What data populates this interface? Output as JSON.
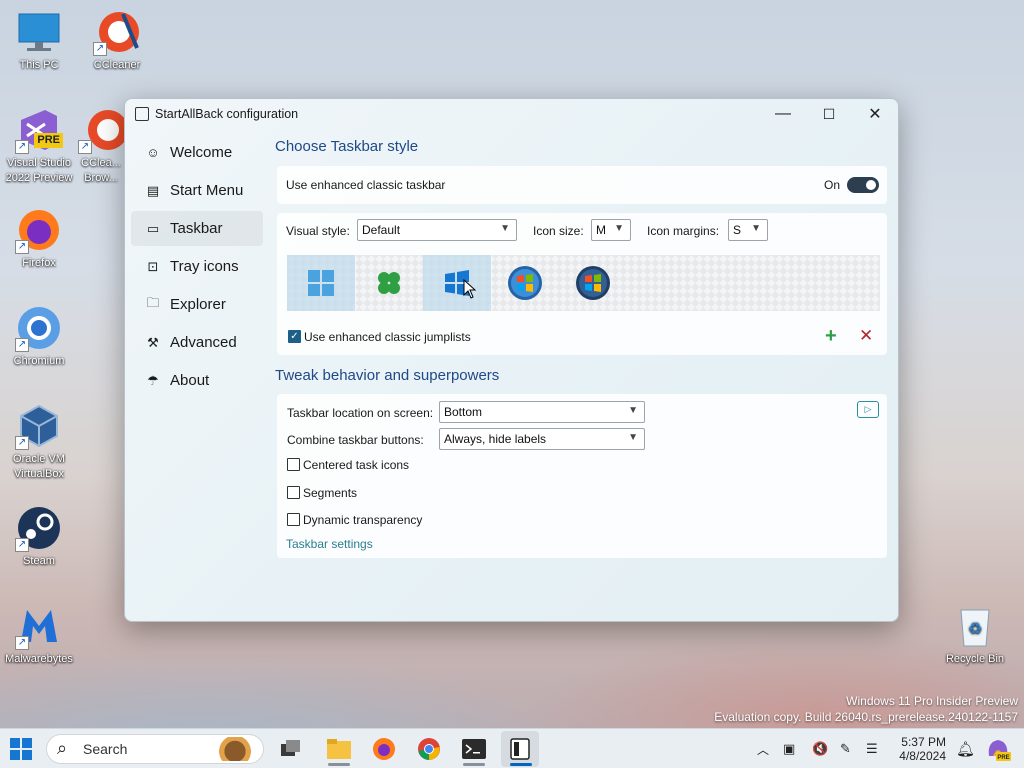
{
  "desktop": {
    "icons": [
      {
        "label": "This PC",
        "icon": "monitor-icon"
      },
      {
        "label": "CCleaner",
        "icon": "ccleaner-icon"
      },
      {
        "label": "Visual Studio 2022 Preview",
        "icon": "visual-studio-icon",
        "badge": "PRE"
      },
      {
        "label": "CClea... Brow...",
        "icon": "ccleaner-browser-icon"
      },
      {
        "label": "Firefox",
        "icon": "firefox-icon"
      },
      {
        "label": "Chromium",
        "icon": "chromium-icon"
      },
      {
        "label": "Oracle VM VirtualBox",
        "icon": "virtualbox-icon"
      },
      {
        "label": "Steam",
        "icon": "steam-icon"
      },
      {
        "label": "Malwarebytes",
        "icon": "malwarebytes-icon"
      },
      {
        "label": "Recycle Bin",
        "icon": "recycle-bin-icon"
      }
    ],
    "watermark_line1": "Windows 11 Pro Insider Preview",
    "watermark_line2": "Evaluation copy. Build 26040.rs_prerelease.240122-1157"
  },
  "window": {
    "title": "StartAllBack configuration",
    "controls": {
      "minimize": "—",
      "maximize": "☐",
      "close": "✕"
    }
  },
  "sidebar": {
    "items": [
      {
        "label": "Welcome",
        "icon": "smile-icon",
        "glyph": "☺"
      },
      {
        "label": "Start Menu",
        "icon": "start-menu-icon",
        "glyph": "▤"
      },
      {
        "label": "Taskbar",
        "icon": "taskbar-icon",
        "glyph": "▭"
      },
      {
        "label": "Tray icons",
        "icon": "tray-icon",
        "glyph": "⊡"
      },
      {
        "label": "Explorer",
        "icon": "folder-icon",
        "glyph": "🗀"
      },
      {
        "label": "Advanced",
        "icon": "wrench-icon",
        "glyph": "⚒"
      },
      {
        "label": "About",
        "icon": "umbrella-icon",
        "glyph": "☂"
      }
    ],
    "active": 2
  },
  "main": {
    "section1_title": "Choose Taskbar style",
    "enhanced_label": "Use enhanced classic taskbar",
    "enhanced_state": "On",
    "visual_style_label": "Visual style:",
    "visual_style_value": "Default",
    "icon_size_label": "Icon size:",
    "icon_size_value": "M",
    "icon_margins_label": "Icon margins:",
    "icon_margins_value": "S",
    "style_options": [
      "win11-logo",
      "clover-logo",
      "win10-logo",
      "win7-orb",
      "vista-orb"
    ],
    "jumplists_label": "Use enhanced classic jumplists",
    "jumplists_checked": true,
    "section2_title": "Tweak behavior and superpowers",
    "location_label": "Taskbar location on screen:",
    "location_value": "Bottom",
    "combine_label": "Combine taskbar buttons:",
    "combine_value": "Always, hide labels",
    "centered_label": "Centered task icons",
    "segments_label": "Segments",
    "dynamic_label": "Dynamic transparency",
    "settings_link": "Taskbar settings"
  },
  "taskbar": {
    "search_placeholder": "Search",
    "time": "5:37 PM",
    "date": "4/8/2024",
    "accent": "#0067c0"
  }
}
